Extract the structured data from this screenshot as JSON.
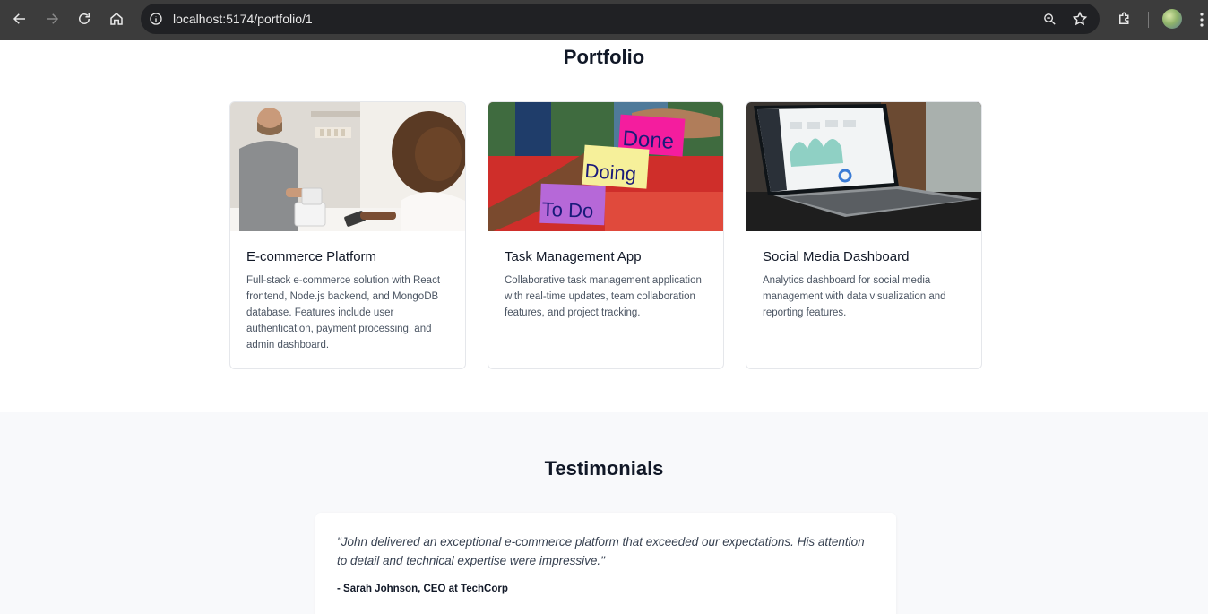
{
  "browser": {
    "url": "localhost:5174/portfolio/1"
  },
  "portfolio": {
    "title": "Portfolio",
    "projects": [
      {
        "title": "E-commerce Platform",
        "description": "Full-stack e-commerce solution with React frontend, Node.js backend, and MongoDB database. Features include user authentication, payment processing, and admin dashboard."
      },
      {
        "title": "Task Management App",
        "description": "Collaborative task management application with real-time updates, team collaboration features, and project tracking.",
        "sticky_notes": [
          "Done",
          "Doing",
          "To Do"
        ]
      },
      {
        "title": "Social Media Dashboard",
        "description": "Analytics dashboard for social media management with data visualization and reporting features."
      }
    ]
  },
  "testimonials": {
    "title": "Testimonials",
    "items": [
      {
        "quote": "\"John delivered an exceptional e-commerce platform that exceeded our expectations. His attention to detail and technical expertise were impressive.\"",
        "author": "- Sarah Johnson, CEO at TechCorp"
      }
    ]
  }
}
